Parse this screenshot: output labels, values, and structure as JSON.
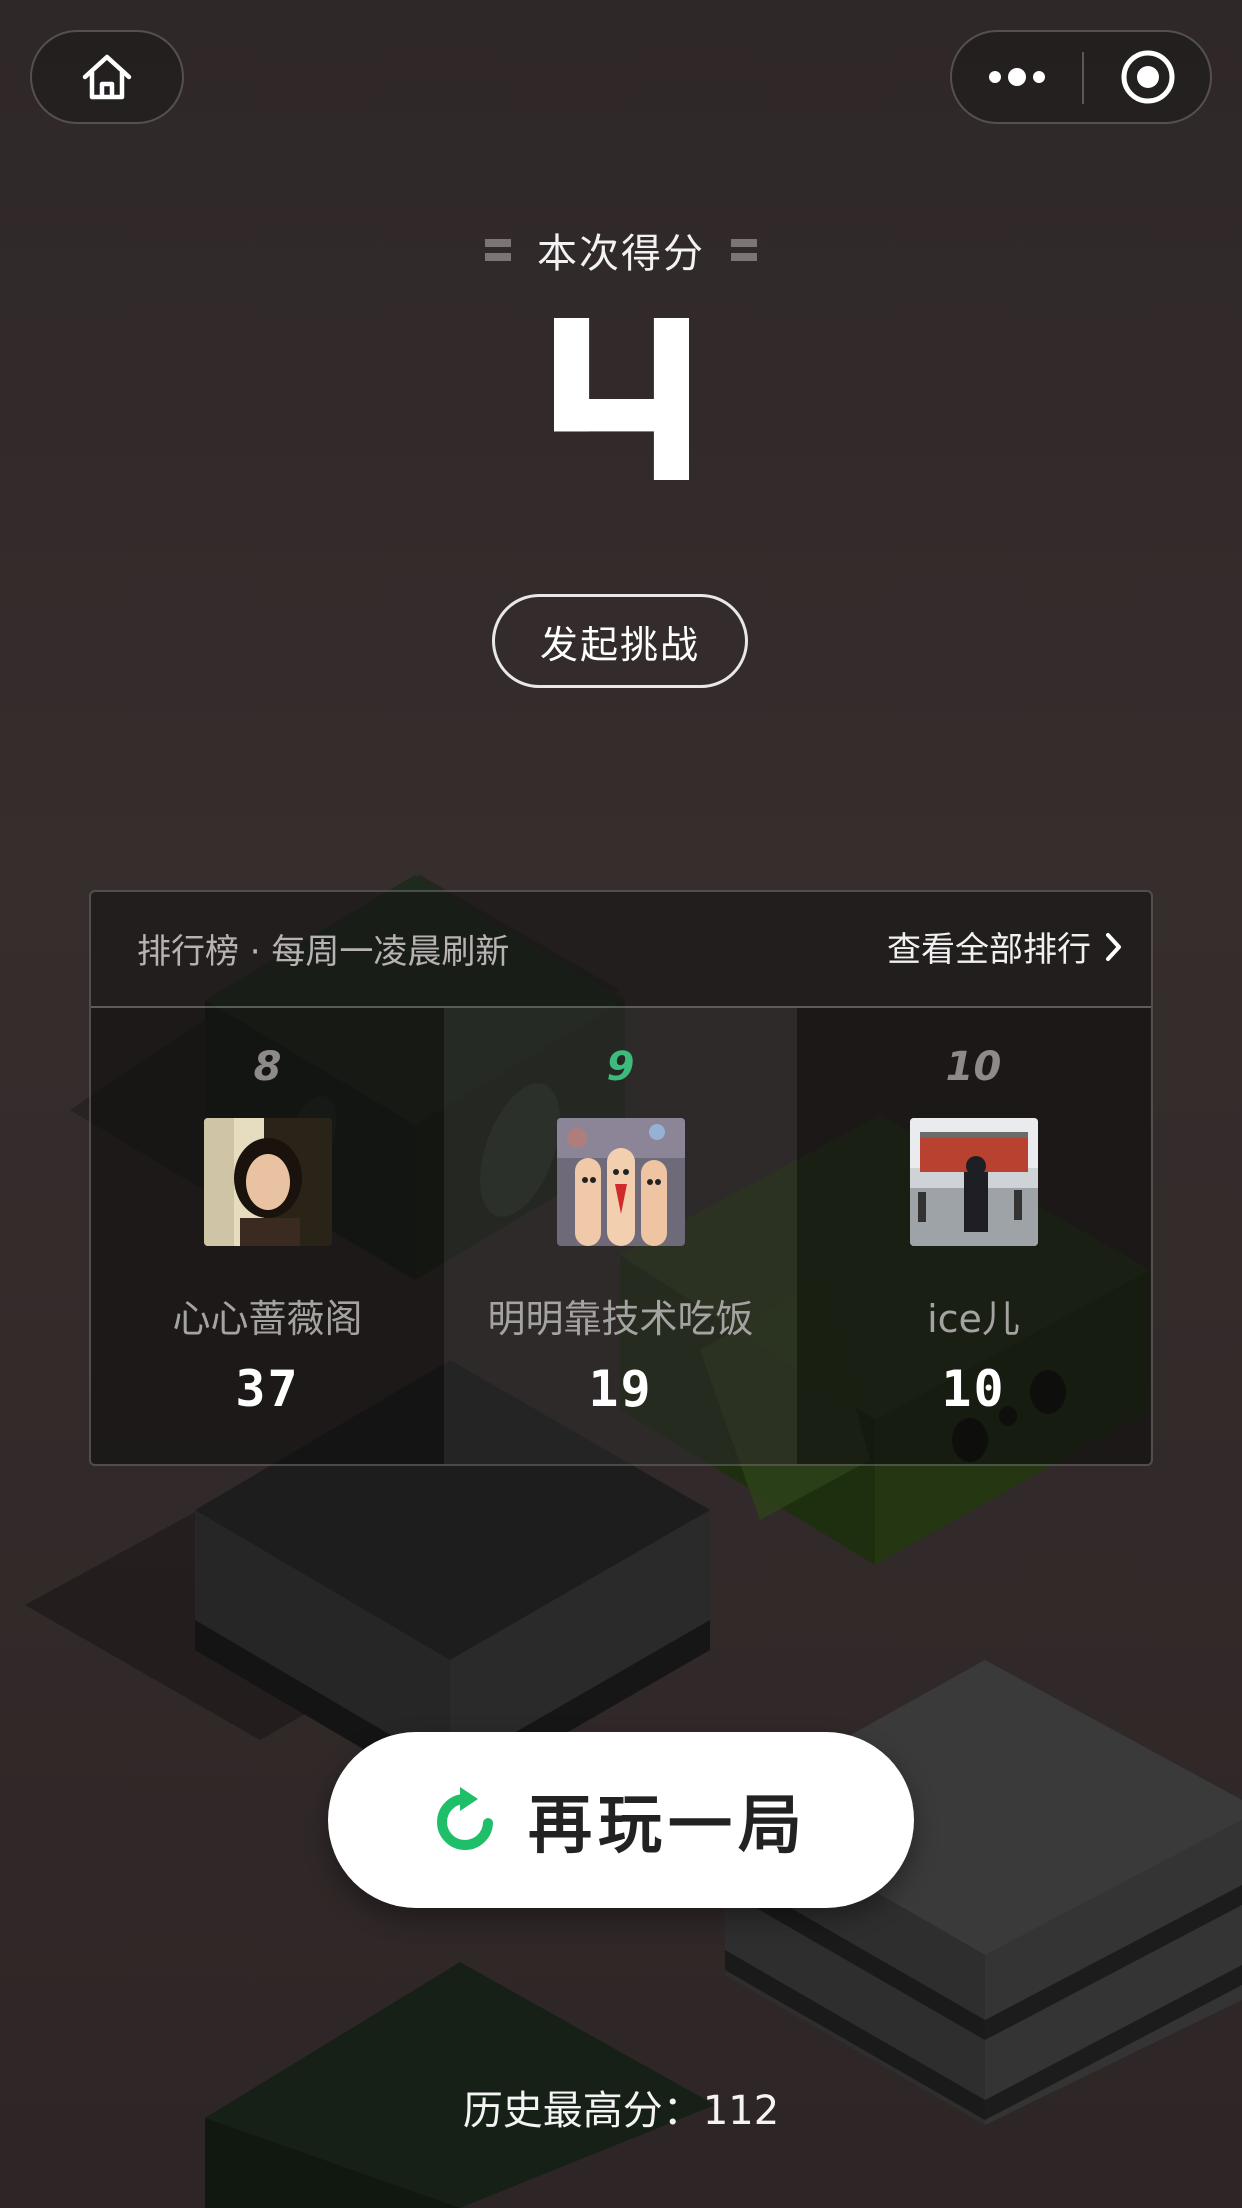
{
  "top_bar": {
    "home_icon": "home-icon",
    "more_icon": "more-dots-icon",
    "close_icon": "target-close-icon"
  },
  "score": {
    "label": "本次得分",
    "value": "4"
  },
  "challenge_button": "发起挑战",
  "leaderboard": {
    "title": "排行榜 · 每周一凌晨刷新",
    "view_all": "查看全部排行",
    "entries": [
      {
        "rank": "8",
        "name": "心心蔷薇阁",
        "score": "37",
        "is_me": false
      },
      {
        "rank": "9",
        "name": "明明靠技术吃饭",
        "score": "19",
        "is_me": true
      },
      {
        "rank": "10",
        "name": "ice儿",
        "score": "10",
        "is_me": false
      }
    ]
  },
  "replay_button": {
    "label": "再玩一局",
    "icon": "replay-icon",
    "icon_color": "#1fbf6a"
  },
  "best": {
    "label": "历史最高分：",
    "value": "112"
  },
  "colors": {
    "background": "#352c2c",
    "accent_green": "#3cbc7c"
  }
}
